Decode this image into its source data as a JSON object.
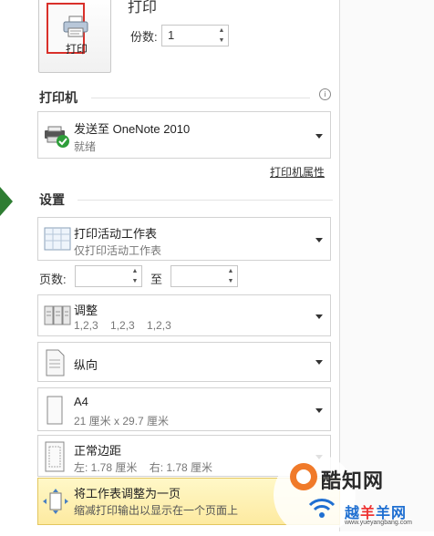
{
  "print": {
    "button_label": "打印",
    "heading": "打印",
    "copies_label": "份数:",
    "copies_value": "1"
  },
  "printer": {
    "section_title": "打印机",
    "name": "发送至 OneNote 2010",
    "status": "就绪",
    "properties_link": "打印机属性"
  },
  "settings": {
    "section_title": "设置",
    "print_what": {
      "title": "打印活动工作表",
      "subtitle": "仅打印活动工作表"
    },
    "pages_label": "页数:",
    "pages_from": "",
    "to_label": "至",
    "pages_to": "",
    "collate": {
      "title": "调整",
      "subtitle": "1,2,3    1,2,3    1,2,3"
    },
    "orientation": {
      "title": "纵向"
    },
    "paper": {
      "title": "A4",
      "subtitle": "21 厘米 x 29.7 厘米"
    },
    "margins": {
      "title": "正常边距",
      "subtitle": "左: 1.78 厘米    右: 1.78 厘米"
    },
    "scaling": {
      "title": "将工作表调整为一页",
      "subtitle": "缩减打印输出以显示在一个页面上"
    }
  },
  "watermark": {
    "brand1": "酷知网",
    "brand2_blue": "越",
    "brand2_red": "羊",
    "brand2_rest": "羊网",
    "url": "www.yueyangbang.com"
  },
  "colors": {
    "accent_green": "#2e7d32",
    "highlight_red": "#d9302a",
    "scaling_bg": "#fdeaa0"
  },
  "icons": [
    "printer-icon",
    "info-icon",
    "printer-onenote-icon",
    "sheet-icon",
    "collate-icon",
    "portrait-icon",
    "paper-icon",
    "margins-icon",
    "fit-page-icon",
    "chevron-down-icon"
  ]
}
